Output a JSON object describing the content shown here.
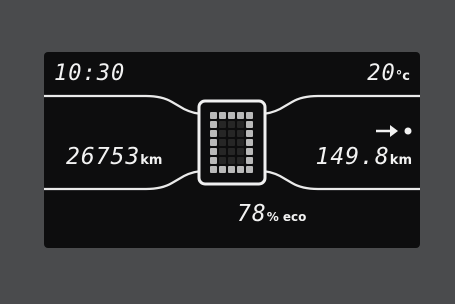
{
  "display": {
    "clock": "10:30",
    "temperature": {
      "value": "20",
      "unit": "°c"
    },
    "odometer": {
      "value": "26753",
      "unit": "km"
    },
    "range": {
      "value": "149.8",
      "unit": "km",
      "icon": "arrow-to-dot-icon"
    },
    "eco_score": {
      "value": "78",
      "unit": "% eco"
    },
    "gear_indicator": {
      "icon": "gear-dot-matrix-icon",
      "pattern": [
        "11111",
        "10001",
        "10001",
        "10001",
        "10001",
        "10001",
        "11111"
      ]
    },
    "colors": {
      "panel": "#0d0d0e",
      "bezel": "#4a4b4d",
      "text": "#f2f2f2",
      "matrix_on": "#b9b9b9"
    }
  }
}
